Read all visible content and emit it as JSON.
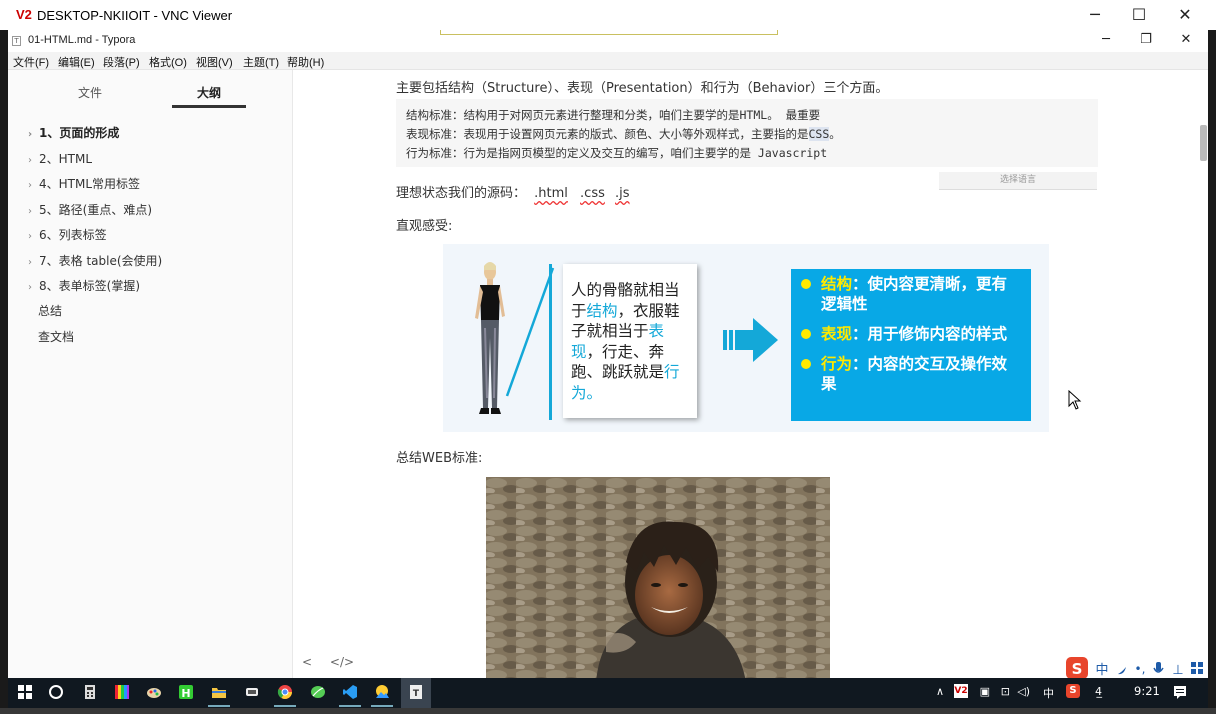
{
  "vnc": {
    "logo": "V2",
    "title": "DESKTOP-NKIIOIT - VNC Viewer",
    "minimize": "─",
    "maximize": "☐",
    "close": "✕"
  },
  "typora": {
    "icon": "T",
    "title": "01-HTML.md - Typora",
    "minimize": "─",
    "restore": "❐",
    "close": "✕",
    "menu": [
      "文件(F)",
      "编辑(E)",
      "段落(P)",
      "格式(O)",
      "视图(V)",
      "主题(T)",
      "帮助(H)"
    ]
  },
  "sidebar": {
    "tab_files": "文件",
    "tab_outline": "大纲",
    "outline": [
      {
        "label": "1、页面的形成",
        "bold": true,
        "chevron": true
      },
      {
        "label": "2、HTML",
        "bold": false,
        "chevron": true
      },
      {
        "label": "4、HTML常用标签",
        "bold": false,
        "chevron": true
      },
      {
        "label": "5、路径(重点、难点)",
        "bold": false,
        "chevron": true
      },
      {
        "label": "6、列表标签",
        "bold": false,
        "chevron": true
      },
      {
        "label": "7、表格 table(会使用)",
        "bold": false,
        "chevron": true
      },
      {
        "label": "8、表单标签(掌握)",
        "bold": false,
        "chevron": true
      },
      {
        "label": "总结",
        "bold": false,
        "chevron": false
      },
      {
        "label": "查文档",
        "bold": false,
        "chevron": false
      }
    ],
    "bottom_prev": "<",
    "bottom_source": "</>"
  },
  "content": {
    "intro": "主要包括结构（Structure）、表现（Presentation）和行为（Behavior）三个方面。",
    "code_lines": [
      {
        "pre": "结构标准：结构用于对网页元素进行整理和分类，咱们主要学的是HTML。 最重要",
        "hl": "",
        "post": ""
      },
      {
        "pre": "表现标准：表现用于设置网页元素的版式、颜色、大小等外观样式，主要指的是",
        "hl": "CSS",
        "post": "。"
      },
      {
        "pre": "行为标准：行为是指网页模型的定义及交互的编写，咱们主要学的是 Javascript",
        "hl": "",
        "post": ""
      }
    ],
    "lang_select": "选择语言",
    "source_label": "理想状态我们的源码：",
    "ext_html": ".html",
    "ext_css": ".css",
    "ext_js": ".js",
    "intuitive": "直观感受:",
    "card": {
      "t1": "人的骨骼就相当于",
      "k1": "结构",
      "t2": "，衣服鞋子就相当于",
      "k2": "表现",
      "t3": "，行走、奔跑、跳跃就是",
      "k3": "行为。"
    },
    "panel": [
      {
        "key": "结构",
        "text": "：使内容更清晰，更有逻辑性"
      },
      {
        "key": "表现",
        "text": "：用于修饰内容的样式"
      },
      {
        "key": "行为",
        "text": "：内容的交互及操作效果"
      }
    ],
    "summary": "总结WEB标准:"
  },
  "tray": {
    "ime_mode": "中",
    "clock": "9:21"
  },
  "colors": {
    "accent_cyan": "#14a8d8",
    "panel_blue": "#08a8e6",
    "panel_yellow": "#ffe900",
    "taskbar": "#101820"
  }
}
